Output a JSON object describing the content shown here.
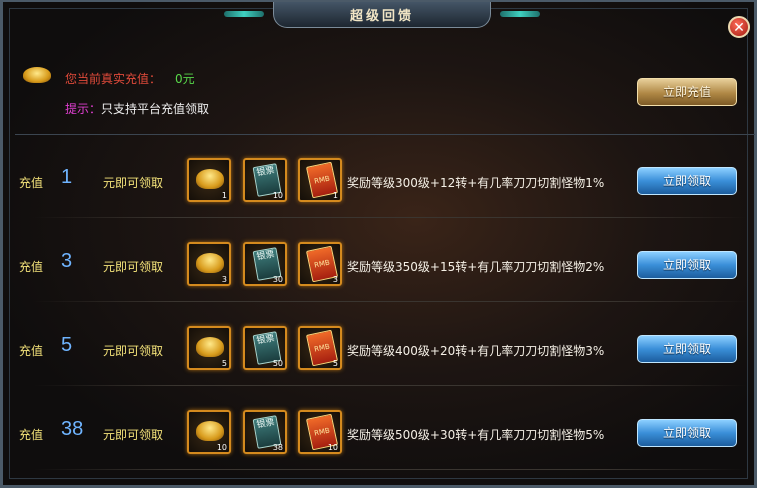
{
  "window": {
    "title": "超级回馈",
    "close_icon": "✕"
  },
  "summary": {
    "current_label": "您当前真实充值：",
    "current_value": "0元",
    "tip_label": "提示：",
    "tip_text": "只支持平台充值领取",
    "recharge_button": "立即充值"
  },
  "tiers": [
    {
      "label": "充值",
      "amount": "1",
      "suffix": "元即可领取",
      "items": [
        {
          "name": "gold-ingot",
          "count": "1"
        },
        {
          "name": "silver-ticket",
          "count": "10",
          "text": "银票"
        },
        {
          "name": "rmb-card",
          "count": "1",
          "text": "RMB"
        }
      ],
      "reward": "奖励等级300级+12转+有几率刀刀切割怪物1%",
      "button": "立即领取"
    },
    {
      "label": "充值",
      "amount": "3",
      "suffix": "元即可领取",
      "items": [
        {
          "name": "gold-ingot",
          "count": "3"
        },
        {
          "name": "silver-ticket",
          "count": "30",
          "text": "银票"
        },
        {
          "name": "rmb-card",
          "count": "3",
          "text": "RMB"
        }
      ],
      "reward": "奖励等级350级+15转+有几率刀刀切割怪物2%",
      "button": "立即领取"
    },
    {
      "label": "充值",
      "amount": "5",
      "suffix": "元即可领取",
      "items": [
        {
          "name": "gold-ingot",
          "count": "5"
        },
        {
          "name": "silver-ticket",
          "count": "50",
          "text": "银票"
        },
        {
          "name": "rmb-card",
          "count": "5",
          "text": "RMB"
        }
      ],
      "reward": "奖励等级400级+20转+有几率刀刀切割怪物3%",
      "button": "立即领取"
    },
    {
      "label": "充值",
      "amount": "38",
      "suffix": "元即可领取",
      "items": [
        {
          "name": "gold-ingot",
          "count": "10"
        },
        {
          "name": "silver-ticket",
          "count": "38",
          "text": "银票"
        },
        {
          "name": "rmb-card",
          "count": "10",
          "text": "RMB"
        }
      ],
      "reward": "奖励等级500级+30转+有几率刀刀切割怪物5%",
      "button": "立即领取"
    }
  ]
}
